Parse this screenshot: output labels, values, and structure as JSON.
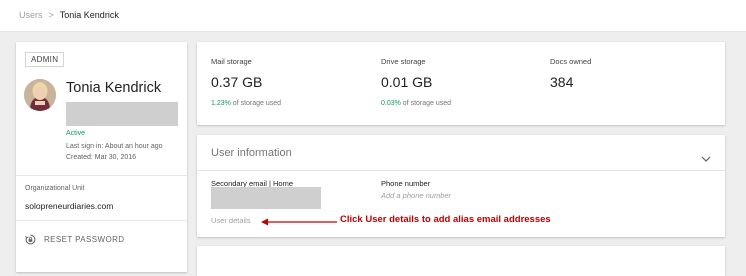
{
  "breadcrumb": {
    "parent": "Users",
    "separator": ">",
    "current": "Tonia Kendrick"
  },
  "profile": {
    "role_badge": "ADMIN",
    "name": "Tonia Kendrick",
    "status": "Active",
    "last_sign_in": "Last sign in: About an hour ago",
    "created": "Created: Mar 30, 2016",
    "org_unit_label": "Organizational Unit",
    "org_unit_value": "solopreneurdiaries.com",
    "reset_password_label": "RESET PASSWORD",
    "avatar_icon": "user-photo",
    "reset_icon": "lock-reset-icon"
  },
  "storage": {
    "mail": {
      "label": "Mail storage",
      "value": "0.37 GB",
      "percent": "1.23%",
      "suffix": " of storage used"
    },
    "drive": {
      "label": "Drive storage",
      "value": "0.01 GB",
      "percent": "0.03%",
      "suffix": " of storage used"
    },
    "docs": {
      "label": "Docs owned",
      "value": "384"
    }
  },
  "user_info": {
    "title": "User information",
    "secondary_email_label": "Secondary email | Home",
    "phone_label": "Phone number",
    "phone_placeholder": "Add a phone number",
    "user_details_link": "User details",
    "chevron_icon": "chevron-down-icon"
  },
  "annotation": {
    "text": "Click User details to add alias email addresses",
    "color": "#c00000"
  },
  "colors": {
    "accent_green": "#0f9d58",
    "background": "#eeeeee"
  }
}
